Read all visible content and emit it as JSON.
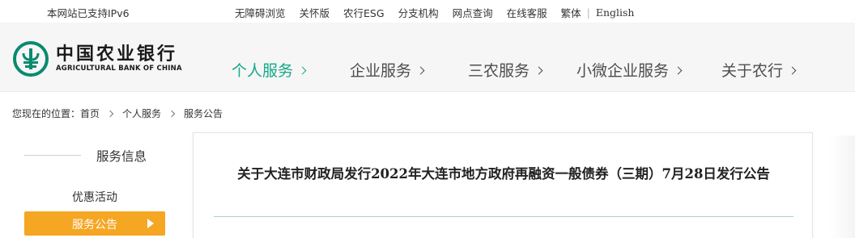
{
  "topbar": {
    "ipv6_text": "本网站已支持IPv6",
    "links": [
      "无障碍浏览",
      "关怀版",
      "农行ESG",
      "分支机构",
      "网点查询",
      "在线客服",
      "繁体"
    ],
    "separator": "|",
    "english": "English"
  },
  "logo": {
    "name_cn": "中国农业银行",
    "name_en": "AGRICULTURAL BANK OF CHINA",
    "brand_color": "#0a8a6f"
  },
  "nav": {
    "items": [
      {
        "label": "个人服务",
        "active": true
      },
      {
        "label": "企业服务",
        "active": false
      },
      {
        "label": "三农服务",
        "active": false
      },
      {
        "label": "小微企业服务",
        "active": false
      },
      {
        "label": "关于农行",
        "active": false
      }
    ],
    "active_color": "#14a889"
  },
  "breadcrumb": {
    "prefix": "您现在的位置：",
    "items": [
      "首页",
      "个人服务",
      "服务公告"
    ]
  },
  "sidebar": {
    "title": "服务信息",
    "items": [
      {
        "label": "优惠活动",
        "active": false
      },
      {
        "label": "服务公告",
        "active": true
      }
    ],
    "active_color": "#f5a623"
  },
  "article": {
    "title": "关于大连市财政局发行2022年大连市地方政府再融资一般债券（三期）7月28日发行公告"
  }
}
